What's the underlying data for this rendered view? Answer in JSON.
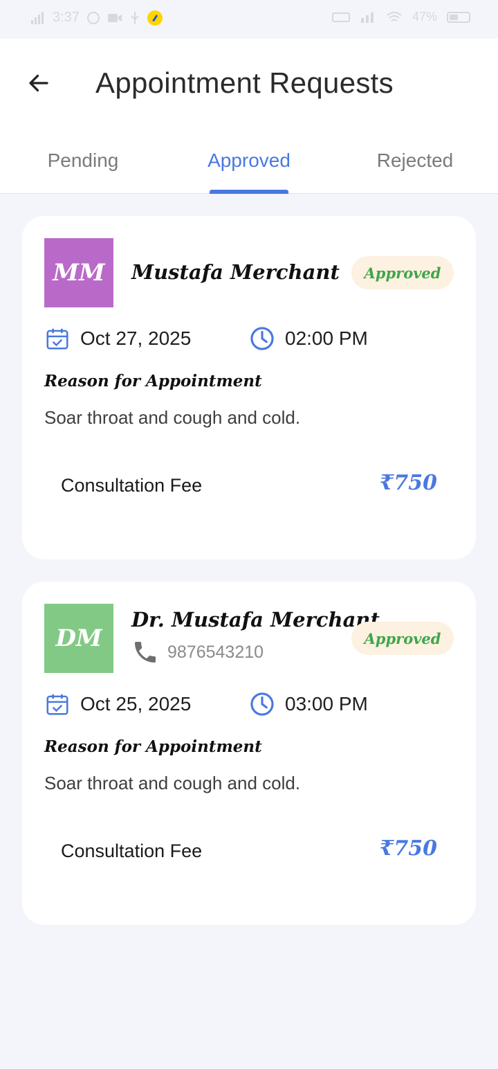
{
  "status_bar": {
    "time": "3:37",
    "battery": "47%"
  },
  "header": {
    "title": "Appointment Requests"
  },
  "tabs": [
    {
      "label": "Pending"
    },
    {
      "label": "Approved"
    },
    {
      "label": "Rejected"
    }
  ],
  "colors": {
    "accent": "#4a78e0",
    "approved_text": "#3fa64a",
    "approved_bg": "#fdf1e1"
  },
  "appointments": [
    {
      "initials": "MM",
      "avatar_color": "#b96ac8",
      "name": "Mustafa Merchant",
      "status": "Approved",
      "date": "Oct 27, 2025",
      "time": "02:00 PM",
      "reason_label": "Reason for Appointment",
      "reason": "Soar throat and cough and cold.",
      "fee_label": "Consultation Fee",
      "fee": "₹750"
    },
    {
      "initials": "DM",
      "avatar_color": "#82c985",
      "name": "Dr. Mustafa Merchant",
      "phone": "9876543210",
      "status": "Approved",
      "date": "Oct 25, 2025",
      "time": "03:00 PM",
      "reason_label": "Reason for Appointment",
      "reason": "Soar throat and cough and cold.",
      "fee_label": "Consultation Fee",
      "fee": "₹750"
    }
  ]
}
